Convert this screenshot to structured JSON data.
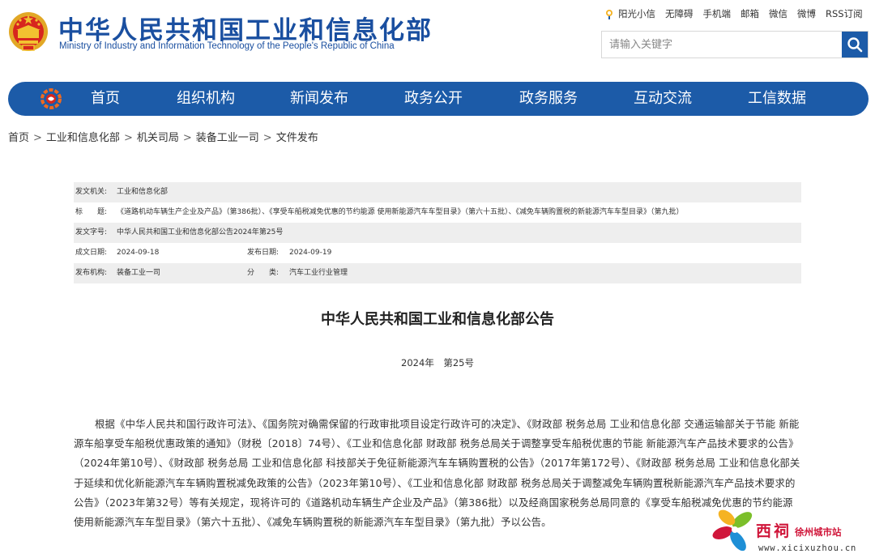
{
  "header": {
    "title": "中华人民共和国工业和信息化部",
    "subtitle": "Ministry of Industry and Information Technology of the People's Republic of China",
    "top_links": [
      "阳光小信",
      "无障碍",
      "手机端",
      "邮箱",
      "微信",
      "微博",
      "RSS订阅"
    ],
    "search_placeholder": "请输入关键字"
  },
  "nav": {
    "items": [
      "首页",
      "组织机构",
      "新闻发布",
      "政务公开",
      "政务服务",
      "互动交流",
      "工信数据"
    ]
  },
  "breadcrumb": [
    "首页",
    "工业和信息化部",
    "机关司局",
    "装备工业一司",
    "文件发布"
  ],
  "meta": {
    "issuer_label": "发文机关:",
    "issuer": "工业和信息化部",
    "title_label": "标　　题:",
    "title": "《道路机动车辆生产企业及产品》（第386批）、《享受车船税减免优惠的节约能源 使用新能源汽车车型目录》（第六十五批）、《减免车辆购置税的新能源汽车车型目录》（第九批）",
    "doc_no_label": "发文字号:",
    "doc_no": "中华人民共和国工业和信息化部公告2024年第25号",
    "created_label": "成文日期:",
    "created": "2024-09-18",
    "published_label": "发布日期:",
    "published": "2024-09-19",
    "org_label": "发布机构:",
    "org": "装备工业一司",
    "category_label": "分　　类:",
    "category": "汽车工业行业管理"
  },
  "document": {
    "title": "中华人民共和国工业和信息化部公告",
    "number": "2024年　第25号",
    "body": "根据《中华人民共和国行政许可法》、《国务院对确需保留的行政审批项目设定行政许可的决定》、《财政部 税务总局 工业和信息化部 交通运输部关于节能 新能源车船享受车船税优惠政策的通知》（财税〔2018〕74号）、《工业和信息化部 财政部 税务总局关于调整享受车船税优惠的节能 新能源汽车产品技术要求的公告》（2024年第10号）、《财政部 税务总局 工业和信息化部 科技部关于免征新能源汽车车辆购置税的公告》（2017年第172号）、《财政部 税务总局 工业和信息化部关于延续和优化新能源汽车车辆购置税减免政策的公告》（2023年第10号）、《工业和信息化部 财政部 税务总局关于调整减免车辆购置税新能源汽车产品技术要求的公告》（2023年第32号）等有关规定，现将许可的《道路机动车辆生产企业及产品》（第386批）以及经商国家税务总局同意的《享受车船税减免优惠的节约能源 使用新能源汽车车型目录》（第六十五批）、《减免车辆购置税的新能源汽车车型目录》（第九批）予以公告。"
  },
  "watermark": {
    "brand": "西祠",
    "city": "徐州城市站",
    "url": "www.xicixuzhou.cn"
  },
  "colors": {
    "primary": "#1c5ba8",
    "emblem_red": "#d7261e",
    "emblem_gold": "#f2c230",
    "watermark_red": "#d0163a"
  }
}
